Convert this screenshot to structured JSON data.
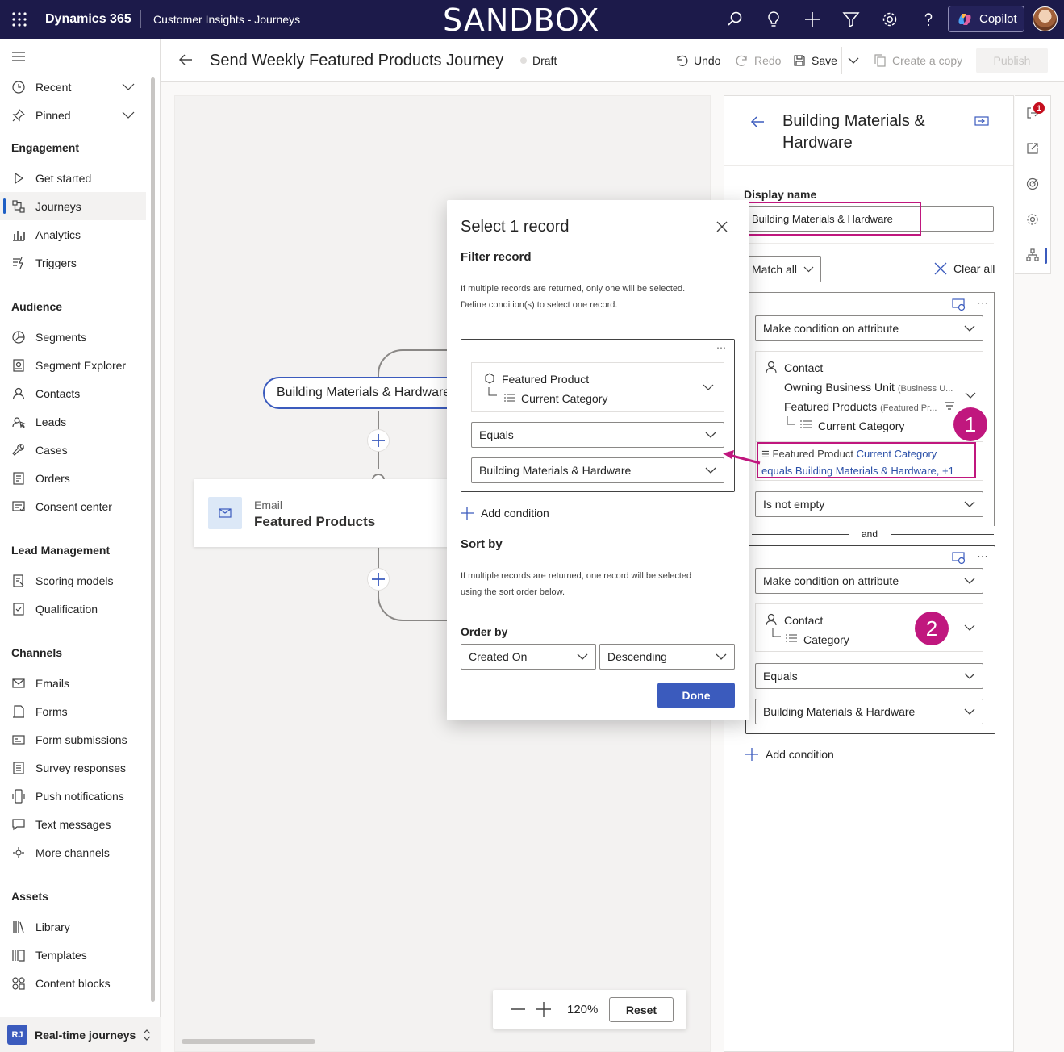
{
  "topbar": {
    "app_name": "Dynamics 365",
    "area": "Customer Insights - Journeys",
    "environment_banner": "SANDBOX",
    "copilot_label": "Copilot"
  },
  "sidebar": {
    "recent": "Recent",
    "pinned": "Pinned",
    "sections": {
      "engagement": "Engagement",
      "audience": "Audience",
      "lead_management": "Lead Management",
      "channels": "Channels",
      "assets": "Assets"
    },
    "engagement_items": [
      "Get started",
      "Journeys",
      "Analytics",
      "Triggers"
    ],
    "audience_items": [
      "Segments",
      "Segment Explorer",
      "Contacts",
      "Leads",
      "Cases",
      "Orders",
      "Consent center"
    ],
    "lead_items": [
      "Scoring models",
      "Qualification"
    ],
    "channel_items": [
      "Emails",
      "Forms",
      "Form submissions",
      "Survey responses",
      "Push notifications",
      "Text messages",
      "More channels"
    ],
    "asset_items": [
      "Library",
      "Templates",
      "Content blocks"
    ],
    "area_switcher": {
      "initials": "RJ",
      "label": "Real-time journeys"
    }
  },
  "header": {
    "title": "Send Weekly Featured Products Journey",
    "status": "Draft",
    "undo": "Undo",
    "redo": "Redo",
    "save": "Save",
    "create_copy": "Create a copy",
    "publish": "Publish"
  },
  "canvas": {
    "branch_label": "Building Materials & Hardware",
    "email_tile": {
      "type": "Email",
      "name": "Featured Products"
    },
    "zoom": {
      "value": "120%",
      "reset": "Reset"
    }
  },
  "modal": {
    "title": "Select 1 record",
    "filter_heading": "Filter record",
    "filter_help": [
      "If multiple records are returned, only one will be selected.",
      "Define condition(s) to select one record."
    ],
    "attribute_entity": "Featured Product",
    "attribute_field": "Current Category",
    "operator": "Equals",
    "value": "Building Materials & Hardware",
    "add_condition": "Add condition",
    "sort_heading": "Sort by",
    "sort_help": [
      "If multiple records are returned, one record will be selected",
      "using the sort order below."
    ],
    "order_by_label": "Order by",
    "order_by_field": "Created On",
    "order_direction": "Descending",
    "done": "Done"
  },
  "panel": {
    "title_line1": "Building Materials &",
    "title_line2": "Hardware",
    "display_name_label": "Display name",
    "display_name_value": "Building Materials & Hardware",
    "match": "Match all",
    "clear_all": "Clear all",
    "group1": {
      "condition_type": "Make condition on attribute",
      "path": {
        "root": "Contact",
        "level1": "Owning Business Unit",
        "level1_hint": "(Business U...",
        "level2": "Featured Products",
        "level2_hint": "(Featured Pr...",
        "leaf": "Current Category"
      },
      "filter_summary_prefix": "Featured Product",
      "filter_summary_field": "Current Category",
      "filter_summary_rest": "equals Building Materials & Hardware, +1",
      "operator": "Is not empty",
      "callout": "1"
    },
    "joiner": "and",
    "group2": {
      "condition_type": "Make condition on attribute",
      "path": {
        "root": "Contact",
        "leaf": "Category"
      },
      "operator": "Equals",
      "value": "Building Materials & Hardware",
      "callout": "2"
    },
    "add_condition": "Add condition"
  },
  "rail": {
    "badge_count": "1"
  },
  "colors": {
    "accent": "#c0177e",
    "primary": "#3b5bbd",
    "topbar": "#1c1a4a",
    "link": "#2b50a8"
  }
}
